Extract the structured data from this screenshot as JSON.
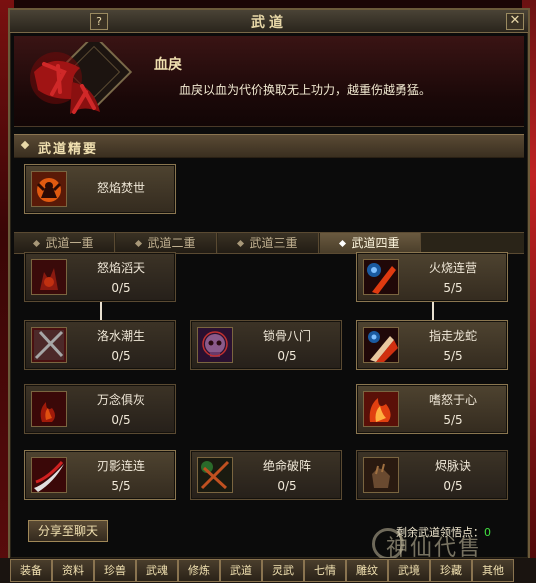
{
  "window": {
    "title": "武道",
    "help": "?",
    "close": "✕"
  },
  "header": {
    "skill_name": "血戾",
    "description": "血戾以血为代价换取无上功力，越重伤越勇猛。",
    "emblem_text": "血戾"
  },
  "section": {
    "title": "武道精要"
  },
  "essence_card": {
    "name": "怒焰焚世"
  },
  "tabs": [
    {
      "label": "武道一重"
    },
    {
      "label": "武道二重"
    },
    {
      "label": "武道三重"
    },
    {
      "label": "武道四重",
      "active": true
    }
  ],
  "skills": [
    {
      "name": "怒焰滔天",
      "points": "0/5"
    },
    {
      "name": "火烧连营",
      "points": "5/5"
    },
    {
      "name": "洛水潮生",
      "points": "0/5"
    },
    {
      "name": "锁骨八门",
      "points": "0/5"
    },
    {
      "name": "指走龙蛇",
      "points": "5/5"
    },
    {
      "name": "万念俱灰",
      "points": "0/5"
    },
    {
      "name": "嗜怒于心",
      "points": "5/5"
    },
    {
      "name": "刃影连连",
      "points": "5/5"
    },
    {
      "name": "绝命破阵",
      "points": "0/5"
    },
    {
      "name": "烬脉诀",
      "points": "0/5"
    }
  ],
  "footer": {
    "share_label": "分享至聊天",
    "remain_label": "剩余武道领悟点：",
    "remain_value": "0"
  },
  "bottom_tabs": [
    "装备",
    "资料",
    "珍兽",
    "武魂",
    "修炼",
    "武道",
    "灵武",
    "七情",
    "雕纹",
    "武境",
    "珍藏",
    "其他"
  ],
  "watermark": "神仙代售",
  "colors": {
    "frame": "#6b5a3a",
    "accent_green": "#40e040",
    "text": "#f0e8d0"
  }
}
